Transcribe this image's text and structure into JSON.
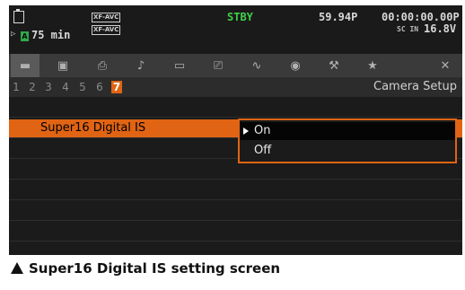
{
  "status": {
    "media_slot": "A",
    "remaining": "75 min",
    "codec_top": "XF-AVC",
    "codec_bottom": "XF-AVC",
    "record_state": "STBY",
    "frame_rate": "59.94P",
    "timecode": "00:00:00.00P",
    "battery_label": "SC IN",
    "voltage": "16.8V",
    "colors": {
      "standby": "#3fcf4a",
      "status_text": "#d8d8d8"
    }
  },
  "tabs": [
    {
      "icon": "camera-icon",
      "glyph": "▬"
    },
    {
      "icon": "image-icon",
      "glyph": "▣"
    },
    {
      "icon": "recording-setup-icon",
      "glyph": "⎙"
    },
    {
      "icon": "audio-icon",
      "glyph": "♪"
    },
    {
      "icon": "monitor-icon",
      "glyph": "▭"
    },
    {
      "icon": "playback-icon",
      "glyph": "⎚"
    },
    {
      "icon": "waveform-icon",
      "glyph": "∿"
    },
    {
      "icon": "network-icon",
      "glyph": "◉"
    },
    {
      "icon": "system-setup-icon",
      "glyph": "⚒"
    },
    {
      "icon": "my-menu-icon",
      "glyph": "★"
    },
    {
      "icon": "close-icon",
      "glyph": "✕"
    }
  ],
  "pages": [
    "1",
    "2",
    "3",
    "4",
    "5",
    "6",
    "7"
  ],
  "active_page": "7",
  "page_title": "Camera Setup",
  "menu": {
    "selected_item": "Super16 Digital IS",
    "options": [
      "On",
      "Off"
    ],
    "selected_option": "On"
  },
  "accent_color": "#e06414",
  "caption": "Super16 Digital IS setting screen"
}
